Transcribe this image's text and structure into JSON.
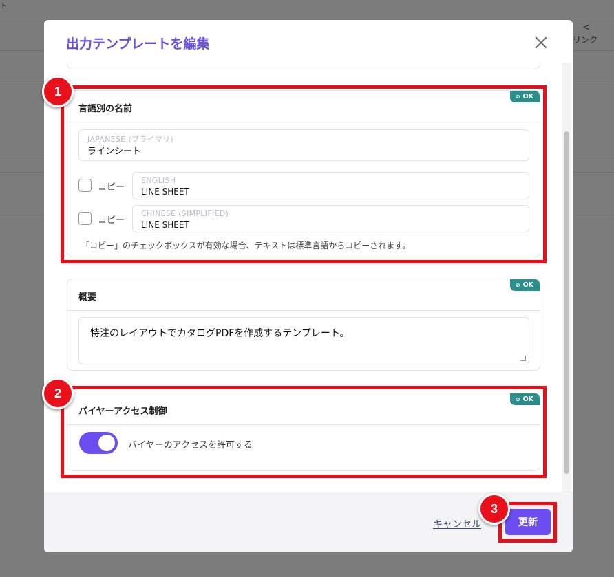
{
  "background": {
    "top_char": "ト",
    "share_label": "リンク",
    "share_icon": "share-icon"
  },
  "modal": {
    "title": "出力テンプレートを編集",
    "close_icon": "close-icon"
  },
  "names_card": {
    "title": "言語別の名前",
    "badge": "OK",
    "primary": {
      "label": "JAPANESE (プライマリ)",
      "value": "ラインシート"
    },
    "copy_label": "コピー",
    "fields": [
      {
        "label": "ENGLISH",
        "value": "LINE SHEET",
        "copy_checked": false
      },
      {
        "label": "CHINESE (SIMPLIFIED)",
        "value": "LINE SHEET",
        "copy_checked": false
      }
    ],
    "note": "「コピー」のチェックボックスが有効な場合、テキストは標準言語からコピーされます。"
  },
  "summary_card": {
    "title": "概要",
    "badge": "OK",
    "text": "特注のレイアウトでカタログPDFを作成するテンプレート。"
  },
  "buyer_card": {
    "title": "バイヤーアクセス制御",
    "badge": "OK",
    "toggle_label": "バイヤーのアクセスを許可する",
    "toggle_on": true
  },
  "footer": {
    "cancel_label": "キャンセル",
    "update_label": "更新"
  },
  "annotations": {
    "step1": "1",
    "step2": "2",
    "step3": "3",
    "highlight_color": "#e8101a"
  },
  "colors": {
    "accent": "#6c4ef0",
    "badge": "#2a8f8b"
  }
}
